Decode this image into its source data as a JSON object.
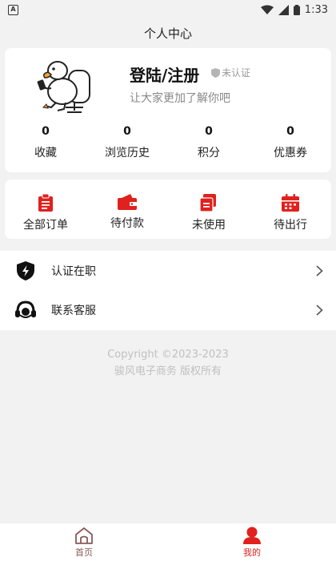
{
  "status_bar": {
    "app_badge": "A",
    "time": "1:33",
    "icons": [
      "wifi-icon",
      "signal-icon",
      "battery-icon"
    ]
  },
  "title": "个人中心",
  "profile": {
    "name": "登陆/注册",
    "cert_status": "未认证",
    "subtitle": "让大家更加了解你吧",
    "avatar": "duck-avatar"
  },
  "stats": [
    {
      "value": "0",
      "label": "收藏"
    },
    {
      "value": "0",
      "label": "浏览历史"
    },
    {
      "value": "0",
      "label": "积分"
    },
    {
      "value": "0",
      "label": "优惠券"
    }
  ],
  "orders": [
    {
      "label": "全部订单",
      "icon": "clipboard-icon"
    },
    {
      "label": "待付款",
      "icon": "wallet-icon"
    },
    {
      "label": "未使用",
      "icon": "ticket-icon"
    },
    {
      "label": "待出行",
      "icon": "calendar-icon"
    }
  ],
  "menu": [
    {
      "label": "认证在职",
      "icon": "shield-bolt-icon"
    },
    {
      "label": "联系客服",
      "icon": "headset-icon"
    }
  ],
  "copyright": {
    "line1": "Copyright ©2023-2023",
    "line2": "骏风电子商务 版权所有"
  },
  "tabs": [
    {
      "label": "首页",
      "icon": "home-icon",
      "active": false
    },
    {
      "label": "我的",
      "icon": "person-icon",
      "active": true
    }
  ],
  "colors": {
    "accent": "#e0211d",
    "background": "#f2f2f2",
    "card": "#ffffff",
    "muted_text": "#888888"
  }
}
